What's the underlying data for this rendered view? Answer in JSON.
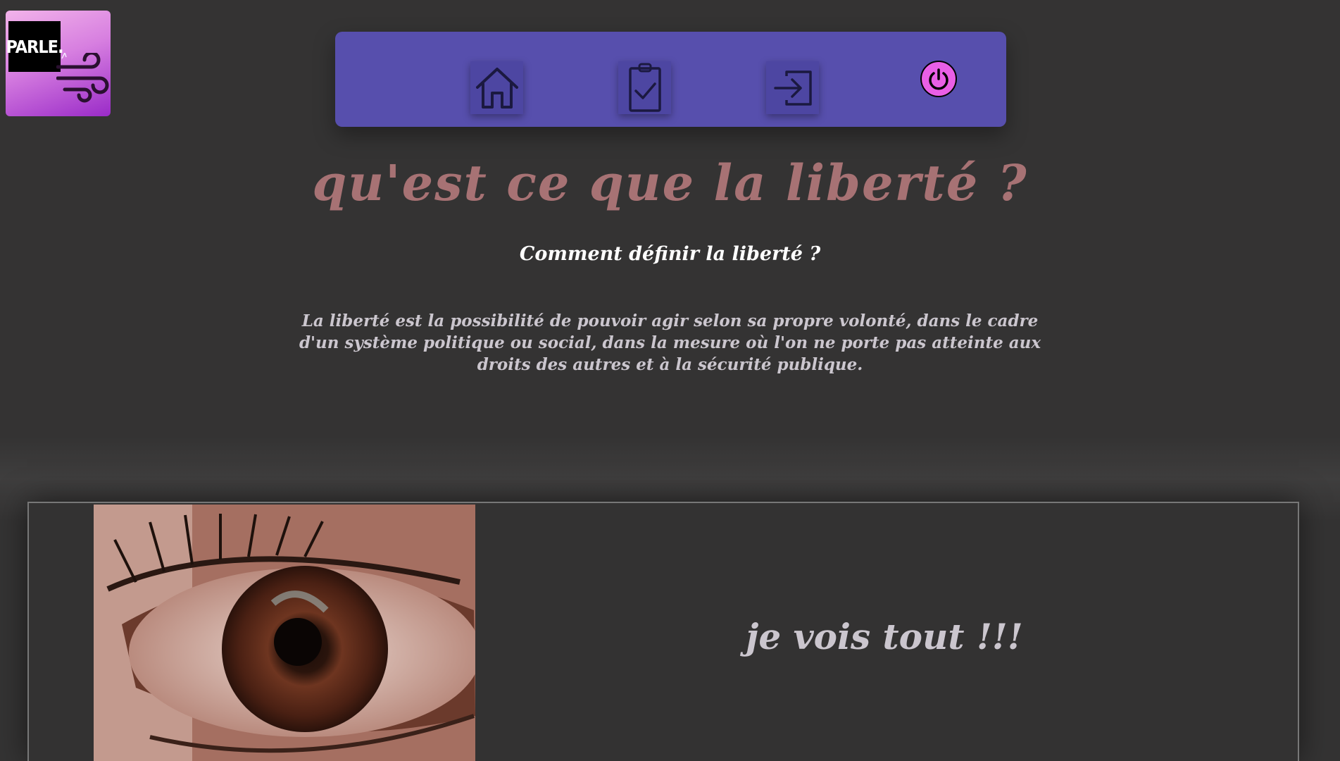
{
  "logo": {
    "text": "PARLE."
  },
  "nav": {
    "home": "home-icon",
    "tasks": "clipboard-check-icon",
    "login": "login-icon",
    "power": "power-icon"
  },
  "main": {
    "title": "qu'est ce que la liberté ?",
    "subtitle": "Comment définir la liberté ?",
    "paragraph": "La liberté est la possibilité de pouvoir agir selon sa propre volonté, dans le cadre d'un système politique ou social, dans la mesure où l'on ne porte pas atteinte aux droits des autres et à la sécurité publique."
  },
  "card": {
    "caption": "je vois tout !!!"
  },
  "colors": {
    "background": "#343333",
    "navbar": "#574fad",
    "title": "#a77274",
    "power": "#e95fe6"
  }
}
